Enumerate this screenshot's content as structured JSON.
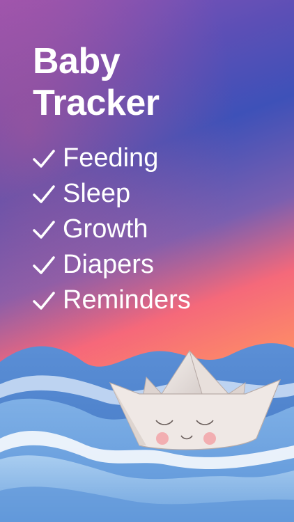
{
  "app": {
    "title_line1": "Baby",
    "title_line2": "Tracker"
  },
  "features": [
    {
      "label": "Feeding"
    },
    {
      "label": "Sleep"
    },
    {
      "label": "Growth"
    },
    {
      "label": "Diapers"
    },
    {
      "label": "Reminders"
    }
  ],
  "icons": {
    "check": "check-icon",
    "boat": "paper-boat-icon"
  },
  "colors": {
    "text": "#ffffff",
    "gradient_top": "#3e51b8",
    "gradient_mid": "#f5697a",
    "gradient_bottom": "#ffc977",
    "water": "#4a7fc9"
  }
}
